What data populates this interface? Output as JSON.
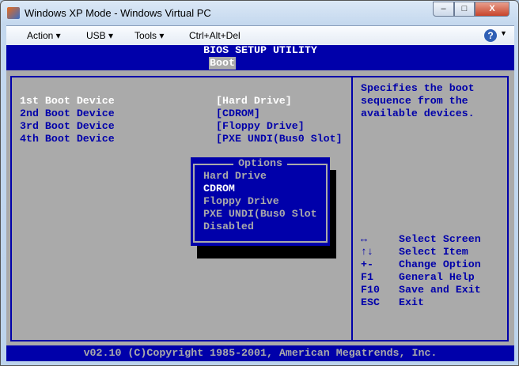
{
  "window": {
    "title": "Windows XP Mode - Windows Virtual PC",
    "min": "–",
    "max": "□",
    "close": "X"
  },
  "toolbar": {
    "items": [
      "Action ▾",
      "USB ▾",
      "Tools ▾",
      "Ctrl+Alt+Del"
    ],
    "help": "?"
  },
  "bios": {
    "title": "BIOS SETUP UTILITY",
    "tab": "Boot",
    "devices": [
      {
        "label": "1st Boot Device",
        "value": "[Hard Drive]"
      },
      {
        "label": "2nd Boot Device",
        "value": "[CDROM]"
      },
      {
        "label": "3rd Boot Device",
        "value": "[Floppy Drive]"
      },
      {
        "label": "4th Boot Device",
        "value": "[PXE UNDI(Bus0 Slot]"
      }
    ],
    "help": [
      "Specifies the boot",
      "sequence from the",
      "available devices."
    ],
    "popup": {
      "title": "Options",
      "items": [
        "Hard Drive",
        "CDROM",
        "Floppy Drive",
        "PXE UNDI(Bus0 Slot",
        "Disabled"
      ],
      "selected": 1
    },
    "keys": [
      {
        "key": "↔",
        "desc": "Select Screen"
      },
      {
        "key": "↑↓",
        "desc": "Select Item"
      },
      {
        "key": "+-",
        "desc": "Change Option"
      },
      {
        "key": "F1",
        "desc": "General Help"
      },
      {
        "key": "F10",
        "desc": "Save and Exit"
      },
      {
        "key": "ESC",
        "desc": "Exit"
      }
    ],
    "footer": "v02.10 (C)Copyright 1985-2001, American Megatrends, Inc."
  },
  "colors": {
    "bios_blue": "#0000aa",
    "bios_gray": "#aaaaaa"
  }
}
